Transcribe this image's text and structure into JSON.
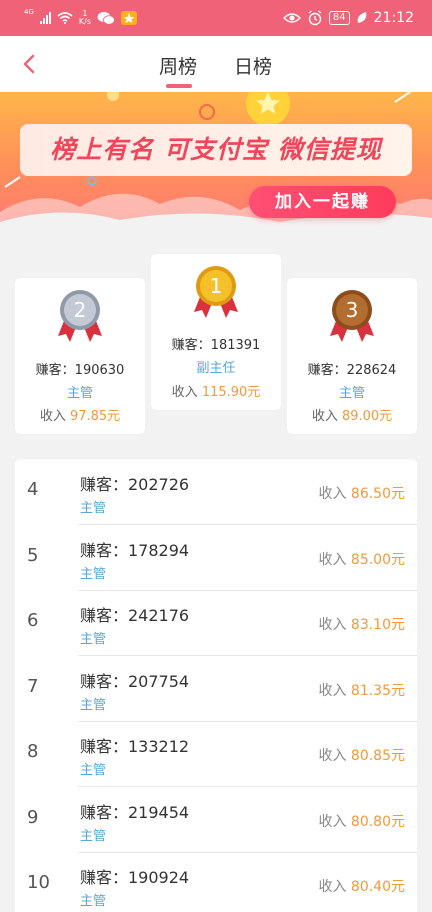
{
  "status_bar": {
    "network_label": "4G",
    "net_speed_value": "1",
    "net_speed_unit": "K/s",
    "battery": "84",
    "time": "21:12"
  },
  "nav": {
    "tabs": [
      {
        "label": "周榜",
        "active": true
      },
      {
        "label": "日榜",
        "active": false
      }
    ]
  },
  "banner": {
    "slogan": "榜上有名 可支付宝 微信提现",
    "join_button": "加入一起赚"
  },
  "podium": [
    {
      "rank": "2",
      "name": "赚客：190630",
      "role": "主管",
      "income_label": "收入",
      "income_amount": "97.85元",
      "medal_color": "#aeb7c6"
    },
    {
      "rank": "1",
      "name": "赚客：181391",
      "role": "副主任",
      "income_label": "收入",
      "income_amount": "115.90元",
      "medal_color": "#f0b41f"
    },
    {
      "rank": "3",
      "name": "赚客：228624",
      "role": "主管",
      "income_label": "收入",
      "income_amount": "89.00元",
      "medal_color": "#b06a2c"
    }
  ],
  "list": [
    {
      "rank": "4",
      "name": "赚客：202726",
      "role": "主管",
      "income_label": "收入",
      "income_amount": "86.50元"
    },
    {
      "rank": "5",
      "name": "赚客：178294",
      "role": "主管",
      "income_label": "收入",
      "income_amount": "85.00元"
    },
    {
      "rank": "6",
      "name": "赚客：242176",
      "role": "主管",
      "income_label": "收入",
      "income_amount": "83.10元"
    },
    {
      "rank": "7",
      "name": "赚客：207754",
      "role": "主管",
      "income_label": "收入",
      "income_amount": "81.35元"
    },
    {
      "rank": "8",
      "name": "赚客：133212",
      "role": "主管",
      "income_label": "收入",
      "income_amount": "80.85元"
    },
    {
      "rank": "9",
      "name": "赚客：219454",
      "role": "主管",
      "income_label": "收入",
      "income_amount": "80.80元"
    },
    {
      "rank": "10",
      "name": "赚客：190924",
      "role": "主管",
      "income_label": "收入",
      "income_amount": "80.40元"
    }
  ],
  "colors": {
    "brand": "#f06277",
    "role_blue": "#54a9d8",
    "amount_orange": "#f29a3b"
  }
}
